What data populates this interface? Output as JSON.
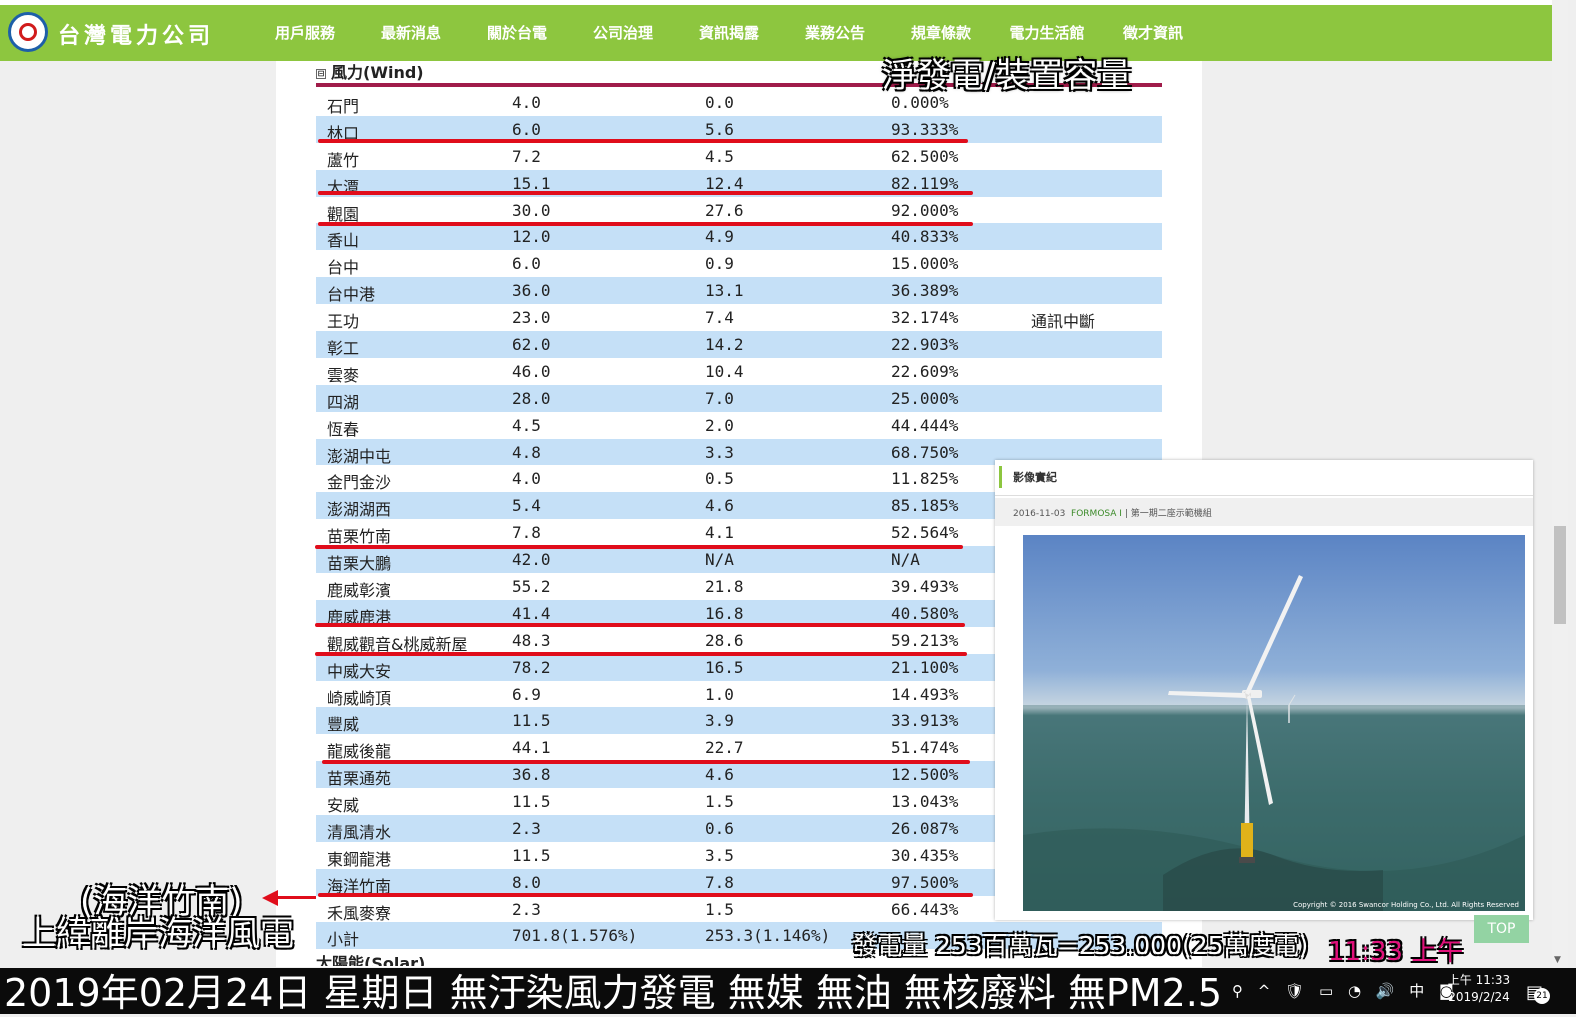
{
  "nav": {
    "brand": "台灣電力公司",
    "items": [
      "用戶服務",
      "最新消息",
      "關於台電",
      "公司治理",
      "資訊揭露",
      "業務公告",
      "規章條款",
      "電力生活館",
      "徵才資訊"
    ]
  },
  "section": {
    "collapse_glyph": "⊟",
    "title": "風力(Wind)"
  },
  "rows": [
    {
      "name": "石門",
      "cap": "4.0",
      "net": "0.0",
      "ratio": "0.000%",
      "note": ""
    },
    {
      "name": "林口",
      "cap": "6.0",
      "net": "5.6",
      "ratio": "93.333%",
      "note": ""
    },
    {
      "name": "蘆竹",
      "cap": "7.2",
      "net": "4.5",
      "ratio": "62.500%",
      "note": ""
    },
    {
      "name": "大潭",
      "cap": "15.1",
      "net": "12.4",
      "ratio": "82.119%",
      "note": ""
    },
    {
      "name": "觀園",
      "cap": "30.0",
      "net": "27.6",
      "ratio": "92.000%",
      "note": ""
    },
    {
      "name": "香山",
      "cap": "12.0",
      "net": "4.9",
      "ratio": "40.833%",
      "note": ""
    },
    {
      "name": "台中",
      "cap": "6.0",
      "net": "0.9",
      "ratio": "15.000%",
      "note": ""
    },
    {
      "name": "台中港",
      "cap": "36.0",
      "net": "13.1",
      "ratio": "36.389%",
      "note": ""
    },
    {
      "name": "王功",
      "cap": "23.0",
      "net": "7.4",
      "ratio": "32.174%",
      "note": "通訊中斷"
    },
    {
      "name": "彰工",
      "cap": "62.0",
      "net": "14.2",
      "ratio": "22.903%",
      "note": ""
    },
    {
      "name": "雲麥",
      "cap": "46.0",
      "net": "10.4",
      "ratio": "22.609%",
      "note": ""
    },
    {
      "name": "四湖",
      "cap": "28.0",
      "net": "7.0",
      "ratio": "25.000%",
      "note": ""
    },
    {
      "name": "恆春",
      "cap": "4.5",
      "net": "2.0",
      "ratio": "44.444%",
      "note": ""
    },
    {
      "name": "澎湖中屯",
      "cap": "4.8",
      "net": "3.3",
      "ratio": "68.750%",
      "note": ""
    },
    {
      "name": "金門金沙",
      "cap": "4.0",
      "net": "0.5",
      "ratio": "11.825%",
      "note": ""
    },
    {
      "name": "澎湖湖西",
      "cap": "5.4",
      "net": "4.6",
      "ratio": "85.185%",
      "note": ""
    },
    {
      "name": "苗栗竹南",
      "cap": "7.8",
      "net": "4.1",
      "ratio": "52.564%",
      "note": ""
    },
    {
      "name": "苗栗大鵬",
      "cap": "42.0",
      "net": "N/A",
      "ratio": "N/A",
      "note": ""
    },
    {
      "name": "鹿威彰濱",
      "cap": "55.2",
      "net": "21.8",
      "ratio": "39.493%",
      "note": ""
    },
    {
      "name": "鹿威鹿港",
      "cap": "41.4",
      "net": "16.8",
      "ratio": "40.580%",
      "note": ""
    },
    {
      "name": "觀威觀音&桃威新屋",
      "cap": "48.3",
      "net": "28.6",
      "ratio": "59.213%",
      "note": ""
    },
    {
      "name": "中威大安",
      "cap": "78.2",
      "net": "16.5",
      "ratio": "21.100%",
      "note": ""
    },
    {
      "name": "崎威崎頂",
      "cap": "6.9",
      "net": "1.0",
      "ratio": "14.493%",
      "note": ""
    },
    {
      "name": "豐威",
      "cap": "11.5",
      "net": "3.9",
      "ratio": "33.913%",
      "note": ""
    },
    {
      "name": "龍威後龍",
      "cap": "44.1",
      "net": "22.7",
      "ratio": "51.474%",
      "note": ""
    },
    {
      "name": "苗栗通苑",
      "cap": "36.8",
      "net": "4.6",
      "ratio": "12.500%",
      "note": ""
    },
    {
      "name": "安威",
      "cap": "11.5",
      "net": "1.5",
      "ratio": "13.043%",
      "note": ""
    },
    {
      "name": "清風清水",
      "cap": "2.3",
      "net": "0.6",
      "ratio": "26.087%",
      "note": ""
    },
    {
      "name": "東鋼龍港",
      "cap": "11.5",
      "net": "3.5",
      "ratio": "30.435%",
      "note": ""
    },
    {
      "name": "海洋竹南",
      "cap": "8.0",
      "net": "7.8",
      "ratio": "97.500%",
      "note": ""
    },
    {
      "name": "禾風麥寮",
      "cap": "2.3",
      "net": "1.5",
      "ratio": "66.443%",
      "note": ""
    }
  ],
  "total": {
    "name": "小計",
    "cap": "701.8(1.576%)",
    "net": "253.3(1.146%)"
  },
  "next_section": "太陽能(Solar)",
  "photo_panel": {
    "header": "影像實紀",
    "date": "2016-11-03",
    "caption_tag": "FORMOSA I",
    "caption_text": "第一期二座示範機組",
    "copyright": "Copyright © 2016 Swancor Holding Co., Ltd. All Rights Reserved"
  },
  "top_button": "TOP",
  "overlays": {
    "title": "淨發電/裝置容量",
    "left_line1": "(海洋竹南)",
    "left_line2": "上緯離岸海洋風電",
    "power": "發電量 253百萬瓦=253.000(25萬度電)",
    "time": "11:33 上午",
    "ticker": "2019年02月24日 星期日  無汙染風力發電 無媒 無油 無核廢料 無PM2.5"
  },
  "taskbar": {
    "tray": [
      "⚲",
      "^",
      "🛡",
      "▭",
      "◔",
      "🔊",
      "中",
      "◙"
    ],
    "clock_time": "上午 11:33",
    "clock_date": "2019/2/24",
    "notif_count": "21"
  },
  "colors": {
    "nav": "#8dc63f",
    "row_alt": "#c5e0f7",
    "underline": "#e00d1b",
    "header_line": "#a01c4a",
    "time": "#e0107a"
  }
}
